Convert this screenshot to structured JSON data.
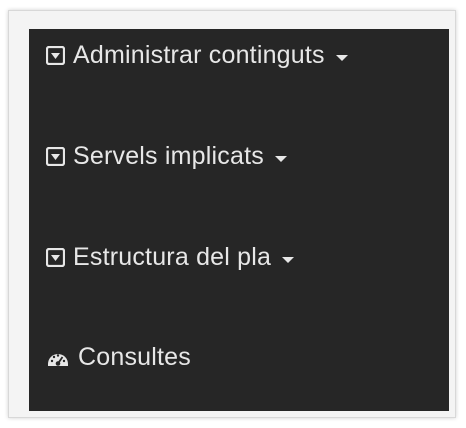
{
  "menu": {
    "items": [
      {
        "label": "Administrar continguts",
        "icon": "caret-square-down-icon",
        "has_dropdown": true
      },
      {
        "label": "Servels implicats",
        "icon": "caret-square-down-icon",
        "has_dropdown": true
      },
      {
        "label": "Estructura del pla",
        "icon": "caret-square-down-icon",
        "has_dropdown": true
      },
      {
        "label": "Consultes",
        "icon": "dashboard-icon",
        "has_dropdown": false
      }
    ]
  },
  "colors": {
    "panel_background": "#262626",
    "text": "#e7e7e7",
    "frame_background": "#f4f4f4"
  }
}
